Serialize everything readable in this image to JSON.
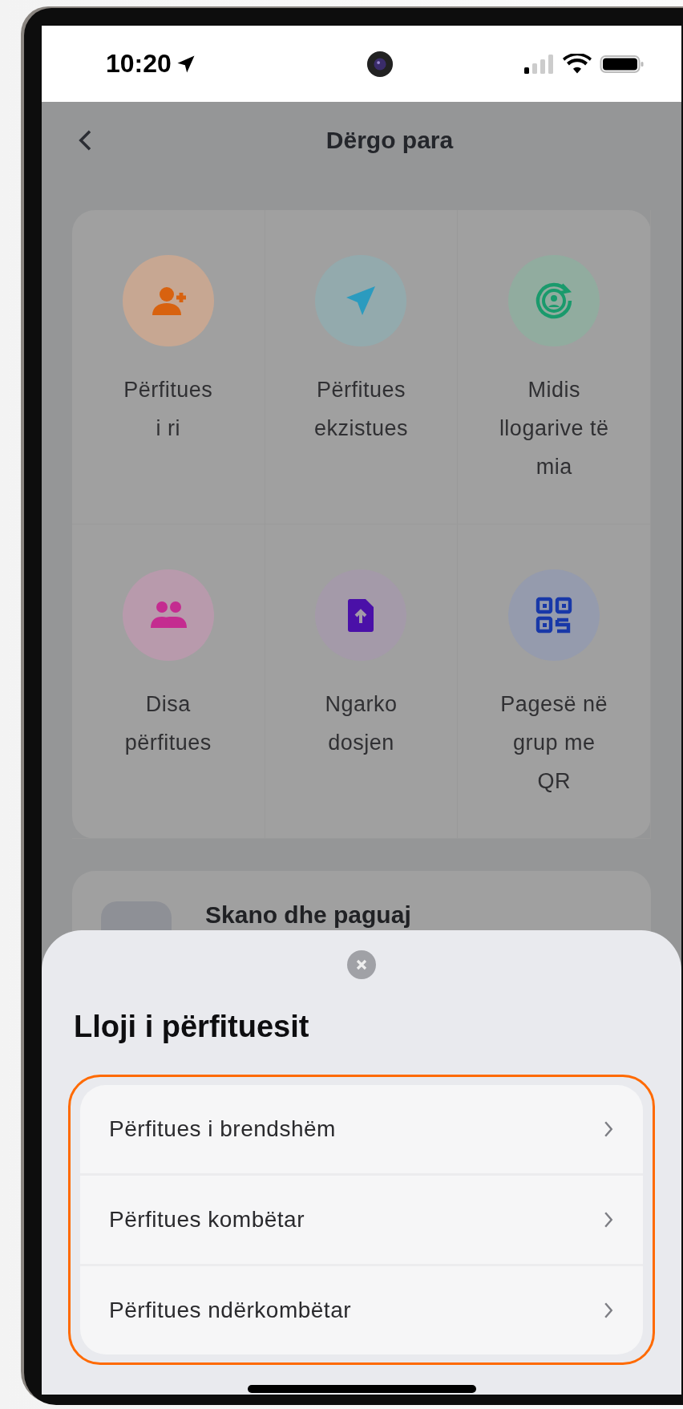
{
  "status_bar": {
    "time": "10:20"
  },
  "header": {
    "title": "Dërgo para"
  },
  "actions": [
    {
      "label": "Përfitues\ni ri",
      "color": "#d8620f"
    },
    {
      "label": "Përfitues\nekzistues",
      "color": "#2b9bbf"
    },
    {
      "label": "Midis\nllogarive të\nmia",
      "color": "#1a9a6c"
    },
    {
      "label": "Disa\npërfitues",
      "color": "#c42c90"
    },
    {
      "label": "Ngarko\ndosjen",
      "color": "#4a10a8"
    },
    {
      "label": "Pagesë në\ngrup me\nQR",
      "color": "#1838a8"
    }
  ],
  "scan_row": {
    "title": "Skano dhe paguaj"
  },
  "sheet": {
    "title": "Lloji i përfituesit",
    "options": [
      {
        "label": "Përfitues i brendshëm"
      },
      {
        "label": "Përfitues kombëtar"
      },
      {
        "label": "Përfitues ndërkombëtar"
      }
    ]
  }
}
